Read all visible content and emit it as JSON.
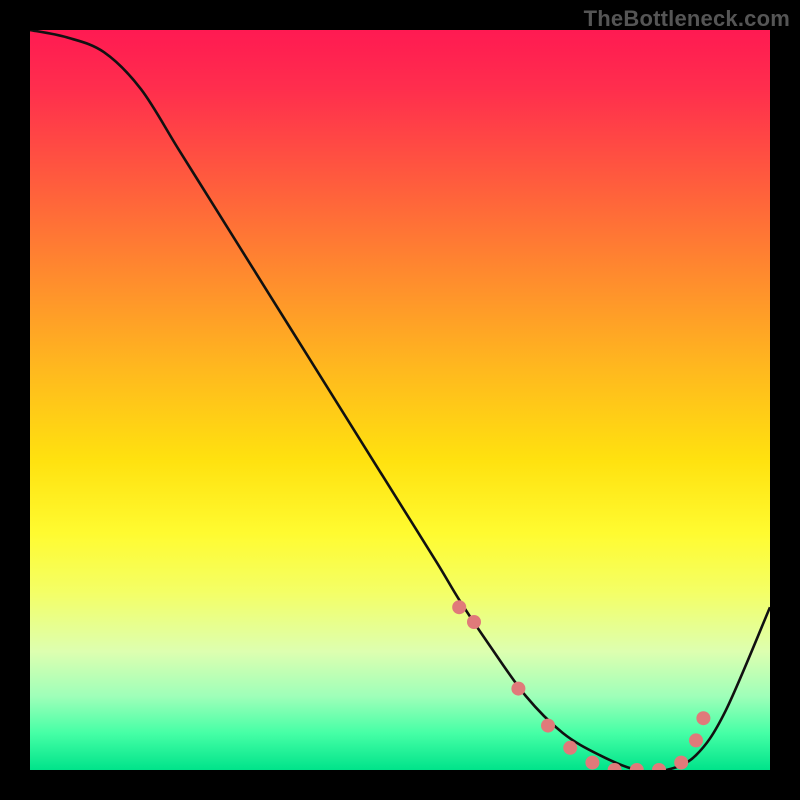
{
  "watermark": "TheBottleneck.com",
  "chart_data": {
    "type": "line",
    "title": "",
    "xlabel": "",
    "ylabel": "",
    "xlim": [
      0,
      100
    ],
    "ylim": [
      0,
      100
    ],
    "grid": false,
    "series": [
      {
        "name": "bottleneck-curve",
        "x": [
          0,
          5,
          10,
          15,
          20,
          25,
          30,
          35,
          40,
          45,
          50,
          55,
          58,
          62,
          67,
          72,
          77,
          82,
          86,
          90,
          94,
          100
        ],
        "values": [
          100,
          99,
          97,
          92,
          84,
          76,
          68,
          60,
          52,
          44,
          36,
          28,
          23,
          17,
          10,
          5,
          2,
          0,
          0,
          2,
          8,
          22
        ]
      }
    ],
    "markers": {
      "name": "flat-region-dots",
      "x": [
        58,
        60,
        66,
        70,
        73,
        76,
        79,
        82,
        85,
        88,
        90,
        91
      ],
      "values": [
        22,
        20,
        11,
        6,
        3,
        1,
        0,
        0,
        0,
        1,
        4,
        7
      ]
    },
    "gradient_stops": [
      {
        "pos": 0,
        "color": "#ff1a52"
      },
      {
        "pos": 50,
        "color": "#ffe10f"
      },
      {
        "pos": 100,
        "color": "#00e38a"
      }
    ]
  }
}
